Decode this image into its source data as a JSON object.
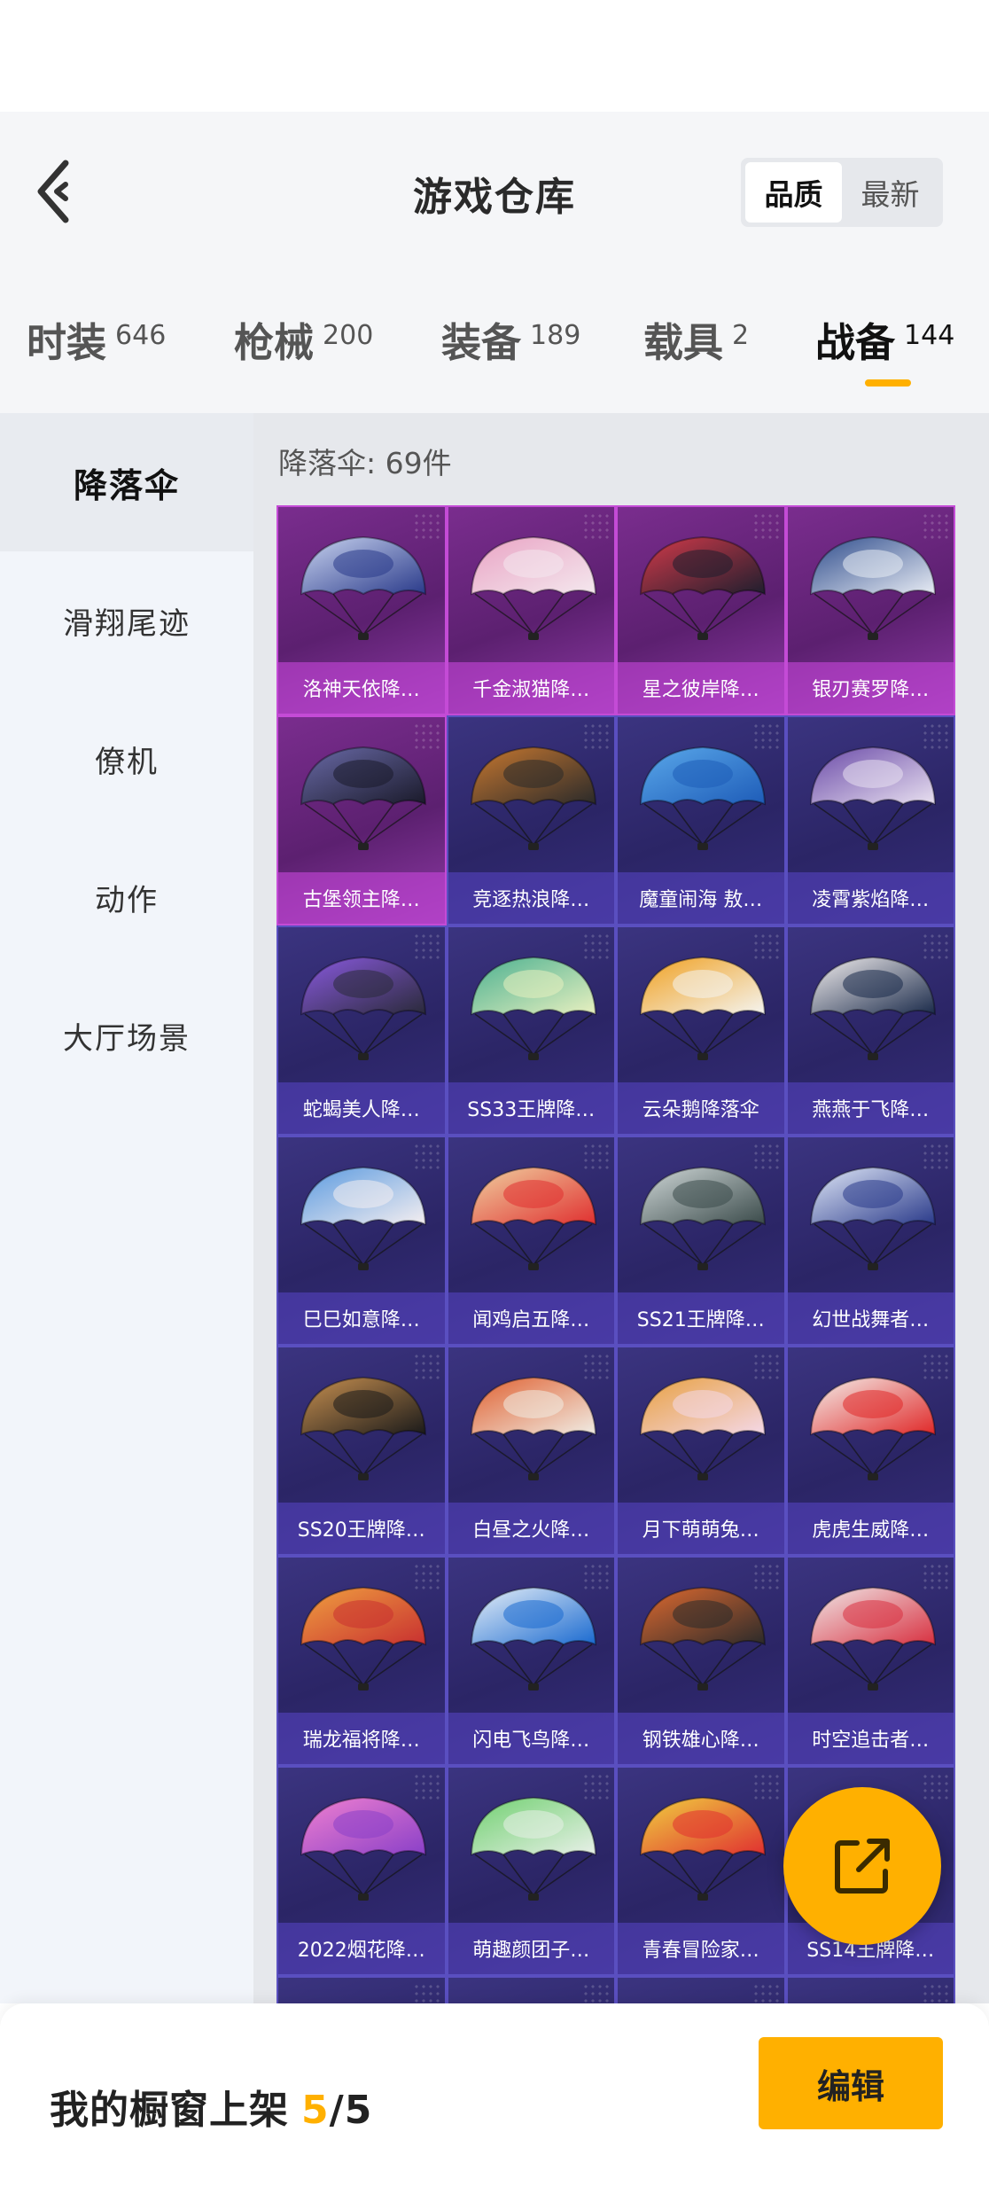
{
  "header": {
    "title": "游戏仓库",
    "sort_options": [
      "品质",
      "最新"
    ],
    "active_sort": "品质"
  },
  "tabs": [
    {
      "label": "时装",
      "count": "646"
    },
    {
      "label": "枪械",
      "count": "200"
    },
    {
      "label": "装备",
      "count": "189"
    },
    {
      "label": "载具",
      "count": "2"
    },
    {
      "label": "战备",
      "count": "144",
      "active": true
    }
  ],
  "sidebar": {
    "items": [
      {
        "label": "降落伞",
        "active": true
      },
      {
        "label": "滑翔尾迹"
      },
      {
        "label": "僚机"
      },
      {
        "label": "动作"
      },
      {
        "label": "大厅场景"
      }
    ]
  },
  "main": {
    "count_label": "降落伞: 69件",
    "items": [
      {
        "name": "洛神天依降…",
        "rarity": "legendary",
        "colors": [
          "#2a3a8a",
          "#c9d4f0"
        ]
      },
      {
        "name": "千金淑猫降…",
        "rarity": "legendary",
        "colors": [
          "#f4e8ee",
          "#e9a3c4"
        ]
      },
      {
        "name": "星之彼岸降…",
        "rarity": "legendary",
        "colors": [
          "#1e1e2e",
          "#d43a4a"
        ]
      },
      {
        "name": "银刃赛罗降…",
        "rarity": "legendary",
        "colors": [
          "#e8ecf4",
          "#2e4c8c"
        ]
      },
      {
        "name": "古堡领主降…",
        "rarity": "legendary",
        "colors": [
          "#1a1a2a",
          "#6a6aa8"
        ]
      },
      {
        "name": "竞逐热浪降…",
        "rarity": "epic",
        "colors": [
          "#2a2a2a",
          "#c87830"
        ]
      },
      {
        "name": "魔童闹海 敖…",
        "rarity": "epic",
        "colors": [
          "#1e5cb8",
          "#5aa8ea"
        ]
      },
      {
        "name": "凌霄紫焰降…",
        "rarity": "epic",
        "colors": [
          "#e8e0f0",
          "#6a4aa8"
        ]
      },
      {
        "name": "蛇蝎美人降…",
        "rarity": "epic",
        "colors": [
          "#2a2a3a",
          "#8a5ae0"
        ]
      },
      {
        "name": "SS33王牌降…",
        "rarity": "epic",
        "colors": [
          "#e8f0c0",
          "#4ab090"
        ]
      },
      {
        "name": "云朵鹅降落伞",
        "rarity": "epic",
        "colors": [
          "#f4f4f0",
          "#f0a020"
        ]
      },
      {
        "name": "燕燕于飞降…",
        "rarity": "epic",
        "colors": [
          "#1a2a4a",
          "#f4f0f0"
        ]
      },
      {
        "name": "巳巳如意降…",
        "rarity": "epic",
        "colors": [
          "#f4eef0",
          "#5a9ae0"
        ]
      },
      {
        "name": "闻鸡启五降…",
        "rarity": "epic",
        "colors": [
          "#e03030",
          "#f0d0a0"
        ]
      },
      {
        "name": "SS21王牌降…",
        "rarity": "epic",
        "colors": [
          "#3a4a4a",
          "#d0d8d8"
        ]
      },
      {
        "name": "幻世战舞者…",
        "rarity": "epic",
        "colors": [
          "#2a3a8a",
          "#e0e8f8"
        ]
      },
      {
        "name": "SS20王牌降…",
        "rarity": "epic",
        "colors": [
          "#1a1a1a",
          "#c89050"
        ]
      },
      {
        "name": "白昼之火降…",
        "rarity": "epic",
        "colors": [
          "#f0ece4",
          "#e06030"
        ]
      },
      {
        "name": "月下萌萌兔…",
        "rarity": "epic",
        "colors": [
          "#f4d8e8",
          "#e8a040"
        ]
      },
      {
        "name": "虎虎生威降…",
        "rarity": "epic",
        "colors": [
          "#e02828",
          "#f4f0ec"
        ]
      },
      {
        "name": "瑞龙福将降…",
        "rarity": "epic",
        "colors": [
          "#c83030",
          "#f0a040"
        ]
      },
      {
        "name": "闪电飞鸟降…",
        "rarity": "epic",
        "colors": [
          "#1a6ad0",
          "#e8f0f8"
        ]
      },
      {
        "name": "钢铁雄心降…",
        "rarity": "epic",
        "colors": [
          "#2a2a2a",
          "#e06a30"
        ]
      },
      {
        "name": "时空追击者…",
        "rarity": "epic",
        "colors": [
          "#d83040",
          "#f0e8e8"
        ]
      },
      {
        "name": "2022烟花降…",
        "rarity": "epic",
        "colors": [
          "#8a40c8",
          "#f080d0"
        ]
      },
      {
        "name": "萌趣颜团子…",
        "rarity": "epic",
        "colors": [
          "#e8f0e8",
          "#70d070"
        ]
      },
      {
        "name": "青春冒险家…",
        "rarity": "epic",
        "colors": [
          "#e03030",
          "#f0d040"
        ]
      },
      {
        "name": "SS14王牌降…",
        "rarity": "epic",
        "colors": [
          "#3a3a4a",
          "#c0c0d0"
        ]
      },
      {
        "name": "",
        "rarity": "epic",
        "colors": [
          "#2a2566",
          "#3b3480"
        ]
      },
      {
        "name": "",
        "rarity": "epic",
        "colors": [
          "#2a2566",
          "#3b3480"
        ]
      },
      {
        "name": "",
        "rarity": "epic",
        "colors": [
          "#2a2566",
          "#3b3480"
        ]
      },
      {
        "name": "",
        "rarity": "epic",
        "colors": [
          "#2a2566",
          "#3b3480"
        ]
      }
    ]
  },
  "bottom": {
    "showcase_label": "我的橱窗上架",
    "showcase_used": "5",
    "showcase_total": "/5",
    "edit_label": "编辑"
  },
  "colors": {
    "accent": "#ffb000",
    "legendary_border": "#c44bd6",
    "epic_border": "#5a4fc0"
  },
  "icons": {
    "back": "chevron-left-icon",
    "share": "share-external-icon"
  }
}
